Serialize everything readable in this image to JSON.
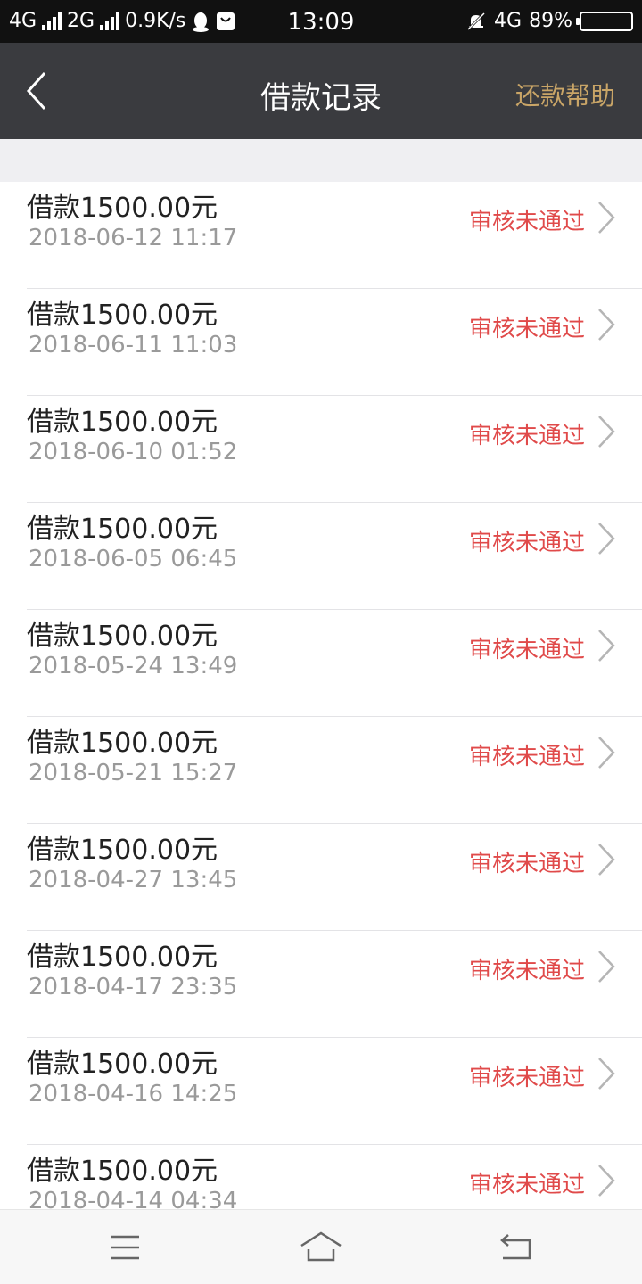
{
  "status_bar": {
    "network1": "4G",
    "network2": "2G",
    "speed": "0.9K/s",
    "time": "13:09",
    "network3": "4G",
    "battery_text": "89%",
    "battery_level": 0.89
  },
  "header": {
    "title": "借款记录",
    "help_label": "还款帮助"
  },
  "records": [
    {
      "amount": "借款1500.00元",
      "time": "2018-06-12 11:17",
      "status": "审核未通过"
    },
    {
      "amount": "借款1500.00元",
      "time": "2018-06-11 11:03",
      "status": "审核未通过"
    },
    {
      "amount": "借款1500.00元",
      "time": "2018-06-10 01:52",
      "status": "审核未通过"
    },
    {
      "amount": "借款1500.00元",
      "time": "2018-06-05 06:45",
      "status": "审核未通过"
    },
    {
      "amount": "借款1500.00元",
      "time": "2018-05-24 13:49",
      "status": "审核未通过"
    },
    {
      "amount": "借款1500.00元",
      "time": "2018-05-21 15:27",
      "status": "审核未通过"
    },
    {
      "amount": "借款1500.00元",
      "time": "2018-04-27 13:45",
      "status": "审核未通过"
    },
    {
      "amount": "借款1500.00元",
      "time": "2018-04-17 23:35",
      "status": "审核未通过"
    },
    {
      "amount": "借款1500.00元",
      "time": "2018-04-16 14:25",
      "status": "审核未通过"
    },
    {
      "amount": "借款1500.00元",
      "time": "2018-04-14 04:34",
      "status": "审核未通过"
    }
  ],
  "colors": {
    "header_bg": "#3a3b3f",
    "help_link": "#c9a567",
    "status_fail": "#e04a4a",
    "amount_text": "#222222",
    "time_text": "#9a9a9a"
  }
}
